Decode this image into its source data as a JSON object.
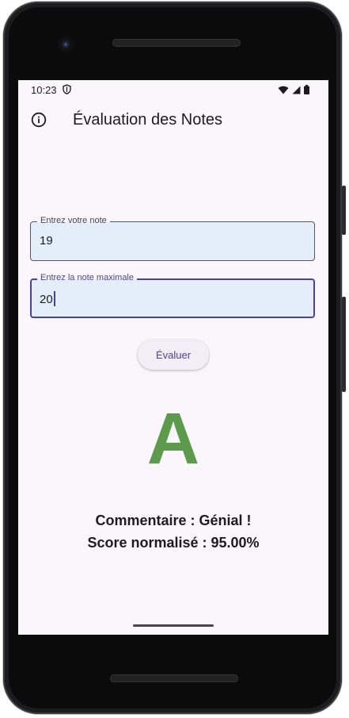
{
  "status_bar": {
    "time": "10:23"
  },
  "app_bar": {
    "title": "Évaluation des Notes"
  },
  "form": {
    "note_label": "Entrez votre note",
    "note_value": "19",
    "max_label": "Entrez la note maximale",
    "max_value": "20"
  },
  "actions": {
    "evaluate_label": "Évaluer"
  },
  "result": {
    "grade": "A",
    "comment": "Commentaire : Génial !",
    "score": "Score normalisé : 95.00%"
  },
  "colors": {
    "grade": "#5b9b4b",
    "accent": "#4c4198",
    "field_bg": "#e3eefa",
    "screen_bg": "#fbf6fc"
  },
  "icons": [
    "info-icon",
    "shield-icon",
    "wifi-icon",
    "signal-icon",
    "battery-icon"
  ]
}
